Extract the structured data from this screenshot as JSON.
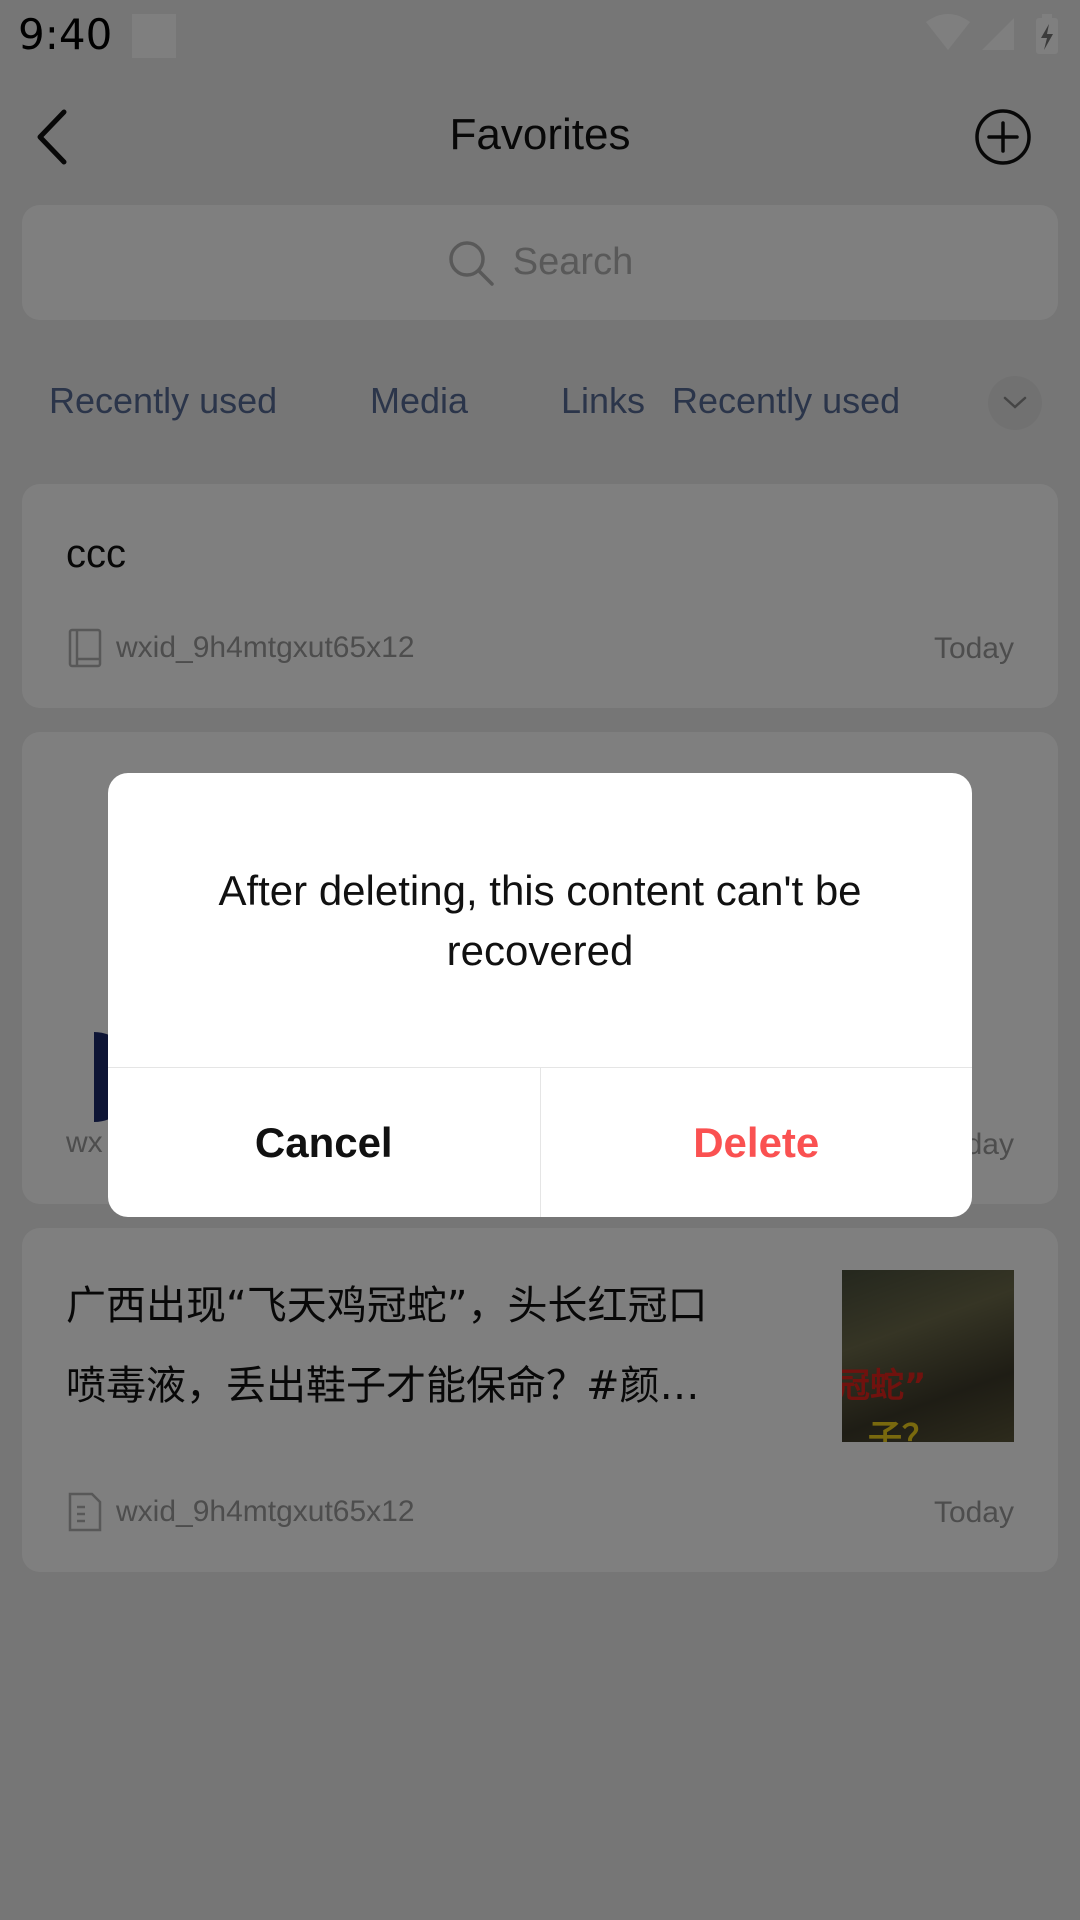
{
  "status_bar": {
    "time": "9:40"
  },
  "header": {
    "title": "Favorites"
  },
  "search": {
    "placeholder": "Search"
  },
  "filters": [
    "Recently used",
    "Media",
    "Links",
    "Recently used"
  ],
  "cards": [
    {
      "text": "ccc",
      "user": "wxid_9h4mtgxut65x12",
      "date": "Today",
      "icon": "note-icon"
    },
    {
      "user": "wx",
      "date": "day"
    },
    {
      "title_line1": "广西出现“飞天鸡冠蛇”，头长红冠口",
      "title_line2": "喷毒液，丢出鞋子才能保命？#颜…",
      "thumb_text_red": "冠蛇”",
      "thumb_text_yellow": "子？",
      "user": "wxid_9h4mtgxut65x12",
      "date": "Today",
      "icon": "article-icon"
    }
  ],
  "dialog": {
    "message_line1": "After deleting, this content can't be",
    "message_line2": "recovered",
    "cancel": "Cancel",
    "delete": "Delete"
  },
  "colors": {
    "link": "#576b95",
    "danger": "#fa5151",
    "background": "#ededed"
  }
}
